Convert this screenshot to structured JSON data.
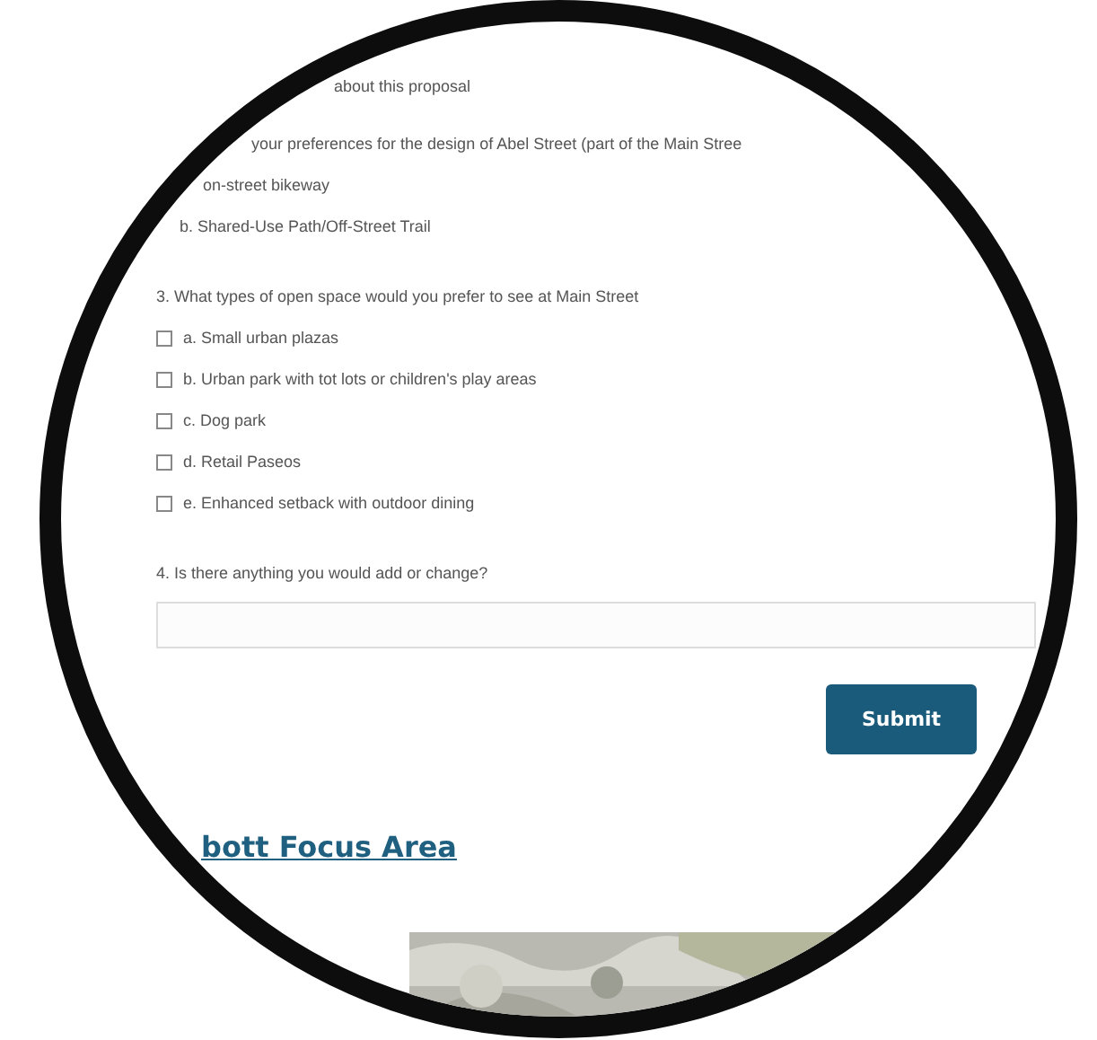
{
  "form": {
    "intro_fragment": "about this proposal",
    "question_2": {
      "text": "your preferences for the design of Abel Street (part of the Main Stree",
      "options": [
        {
          "label": "on-street bikeway"
        },
        {
          "label": "b. Shared-Use Path/Off-Street Trail"
        }
      ]
    },
    "question_3": {
      "text": "3. What types of open space would you prefer to see at Main Street",
      "options": [
        {
          "label": "a. Small urban plazas",
          "checked": false
        },
        {
          "label": "b. Urban park with tot lots or children's play areas",
          "checked": false
        },
        {
          "label": "c. Dog park",
          "checked": false
        },
        {
          "label": "d. Retail Paseos",
          "checked": false
        },
        {
          "label": "e. Enhanced setback with outdoor dining",
          "checked": false
        }
      ]
    },
    "question_4": {
      "text": "4. Is there anything you would add or change?"
    },
    "submit": "Submit"
  },
  "section_link": "bott Focus Area"
}
